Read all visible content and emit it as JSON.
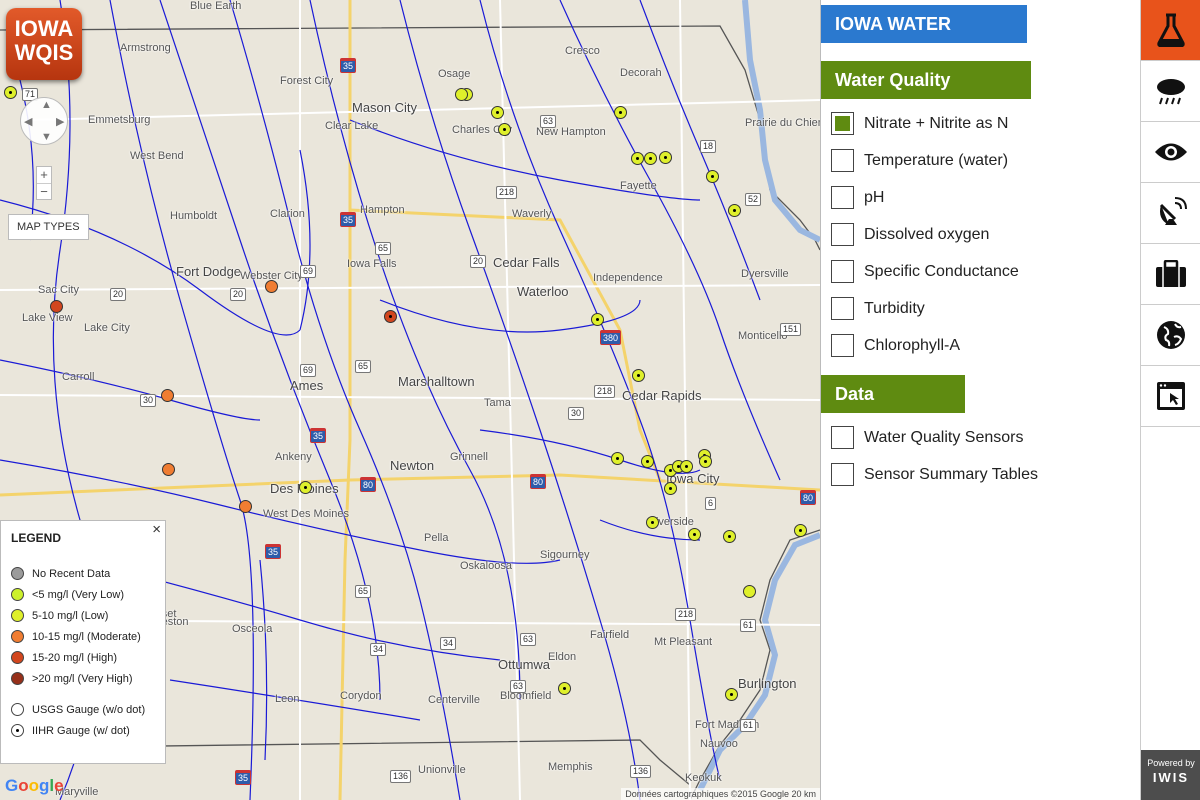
{
  "logo": {
    "line1": "IOWA",
    "line2": "WQIS"
  },
  "map": {
    "controls": {
      "zoom_in": "+",
      "zoom_out": "−",
      "map_types": "MAP TYPES"
    },
    "cities": [
      {
        "name": "Blue Earth"
      },
      {
        "name": "Armstrong"
      },
      {
        "name": "Forest City"
      },
      {
        "name": "Osage"
      },
      {
        "name": "Cresco"
      },
      {
        "name": "Decorah"
      },
      {
        "name": "Mason City"
      },
      {
        "name": "Clear Lake"
      },
      {
        "name": "Charles City"
      },
      {
        "name": "New Hampton"
      },
      {
        "name": "Emmetsburg"
      },
      {
        "name": "West Bend"
      },
      {
        "name": "Humboldt"
      },
      {
        "name": "Clarion"
      },
      {
        "name": "Hampton"
      },
      {
        "name": "Waverly"
      },
      {
        "name": "Fayette"
      },
      {
        "name": "Prairie du Chien"
      },
      {
        "name": "Fort Dodge"
      },
      {
        "name": "Webster City"
      },
      {
        "name": "Iowa Falls"
      },
      {
        "name": "Cedar Falls"
      },
      {
        "name": "Waterloo"
      },
      {
        "name": "Independence"
      },
      {
        "name": "Dyersville"
      },
      {
        "name": "Sac City"
      },
      {
        "name": "Lake View"
      },
      {
        "name": "Lake City"
      },
      {
        "name": "Monticello"
      },
      {
        "name": "Carroll"
      },
      {
        "name": "Ames"
      },
      {
        "name": "Marshalltown"
      },
      {
        "name": "Tama"
      },
      {
        "name": "Cedar Rapids"
      },
      {
        "name": "Ankeny"
      },
      {
        "name": "Newton"
      },
      {
        "name": "Grinnell"
      },
      {
        "name": "Des Moines"
      },
      {
        "name": "West Des Moines"
      },
      {
        "name": "Iowa City"
      },
      {
        "name": "Pella"
      },
      {
        "name": "Riverside"
      },
      {
        "name": "Sigourney"
      },
      {
        "name": "Oskaloosa"
      },
      {
        "name": "Winterset"
      },
      {
        "name": "Osceola"
      },
      {
        "name": "Ottumwa"
      },
      {
        "name": "Fairfield"
      },
      {
        "name": "Mt Pleasant"
      },
      {
        "name": "Creston"
      },
      {
        "name": "Eldon"
      },
      {
        "name": "Burlington"
      },
      {
        "name": "Leon"
      },
      {
        "name": "Corydon"
      },
      {
        "name": "Centerville"
      },
      {
        "name": "Bloomfield"
      },
      {
        "name": "Fort Madison"
      },
      {
        "name": "Nauvoo"
      },
      {
        "name": "Unionville"
      },
      {
        "name": "Memphis"
      },
      {
        "name": "Keokuk"
      },
      {
        "name": "Maryville"
      }
    ],
    "routes": [
      "71",
      "35",
      "63",
      "18",
      "218",
      "52",
      "35",
      "65",
      "20",
      "20",
      "20",
      "380",
      "151",
      "30",
      "69",
      "65",
      "218",
      "30",
      "35",
      "80",
      "80",
      "6",
      "218",
      "35",
      "65",
      "34",
      "63",
      "61",
      "136",
      "35",
      "136",
      "61",
      "34",
      "63",
      "69",
      "80"
    ],
    "stations": [
      {
        "status": "low",
        "type": "iihr"
      },
      {
        "status": "low",
        "type": "iihr"
      },
      {
        "status": "low",
        "type": "iihr"
      },
      {
        "status": "low",
        "type": "iihr"
      },
      {
        "status": "low",
        "type": "iihr"
      },
      {
        "status": "low",
        "type": "iihr"
      },
      {
        "status": "low",
        "type": "iihr"
      },
      {
        "status": "low",
        "type": "iihr"
      },
      {
        "status": "low",
        "type": "iihr"
      },
      {
        "status": "low",
        "type": "iihr"
      },
      {
        "status": "low",
        "type": "iihr"
      },
      {
        "status": "low",
        "type": "iihr"
      },
      {
        "status": "low",
        "type": "iihr"
      },
      {
        "status": "low",
        "type": "iihr"
      },
      {
        "status": "low",
        "type": "iihr"
      },
      {
        "status": "low",
        "type": "iihr"
      },
      {
        "status": "low",
        "type": "iihr"
      },
      {
        "status": "low",
        "type": "iihr"
      },
      {
        "status": "low",
        "type": "iihr"
      },
      {
        "status": "low",
        "type": "iihr"
      },
      {
        "status": "low",
        "type": "iihr"
      },
      {
        "status": "low",
        "type": "iihr"
      },
      {
        "status": "low",
        "type": "iihr"
      },
      {
        "status": "low",
        "type": "iihr"
      },
      {
        "status": "low",
        "type": "usgs"
      },
      {
        "status": "low",
        "type": "iihr"
      },
      {
        "status": "low",
        "type": "iihr"
      },
      {
        "status": "low",
        "type": "iihr"
      },
      {
        "status": "moderate",
        "type": "usgs"
      },
      {
        "status": "moderate",
        "type": "usgs"
      },
      {
        "status": "moderate",
        "type": "usgs"
      },
      {
        "status": "moderate",
        "type": "usgs"
      },
      {
        "status": "high",
        "type": "usgs"
      },
      {
        "status": "high",
        "type": "iihr"
      },
      {
        "status": "low",
        "type": "usgs"
      }
    ],
    "attribution": "Données cartographiques ©2015 Google   20 km",
    "google": "Google"
  },
  "legend": {
    "title": "LEGEND",
    "close": "×",
    "items": [
      {
        "label": "No Recent Data",
        "color": "#9b9b9b"
      },
      {
        "label": "<5 mg/l (Very Low)",
        "color": "#ccf02b"
      },
      {
        "label": "5-10 mg/l (Low)",
        "color": "#dff02b"
      },
      {
        "label": "10-15 mg/l (Moderate)",
        "color": "#f07d32"
      },
      {
        "label": "15-20 mg/l (High)",
        "color": "#d2461e"
      },
      {
        "label": ">20 mg/l (Very High)",
        "color": "#96301a"
      }
    ],
    "gauges": [
      {
        "label": "USGS Gauge (w/o dot)"
      },
      {
        "label": "IIHR Gauge (w/ dot)"
      }
    ]
  },
  "panel": {
    "title": "IOWA WATER QUALITY IS",
    "conditions_title": "Water Quality Conditions",
    "conditions": [
      {
        "label": "Nitrate + Nitrite as N",
        "checked": true
      },
      {
        "label": "Temperature (water)",
        "checked": false
      },
      {
        "label": "pH",
        "checked": false
      },
      {
        "label": "Dissolved oxygen",
        "checked": false
      },
      {
        "label": "Specific Conductance",
        "checked": false
      },
      {
        "label": "Turbidity",
        "checked": false
      },
      {
        "label": "Chlorophyll-A",
        "checked": false
      }
    ],
    "resources_title": "Data Resources",
    "resources": [
      {
        "label": "Water Quality Sensors",
        "checked": false
      },
      {
        "label": "Sensor Summary Tables",
        "checked": false
      }
    ]
  },
  "iconbar": {
    "icons": [
      "flask-icon",
      "rain-cloud-icon",
      "eye-icon",
      "satellite-dish-icon",
      "briefcase-icon",
      "globe-icon",
      "browser-window-icon"
    ],
    "powered_by": "Powered by",
    "brand": "IWIS"
  },
  "colors": {
    "accent": "#e8531b",
    "green": "#5f8b11",
    "blue": "#2b79cf",
    "river": "#1a1ad6"
  }
}
